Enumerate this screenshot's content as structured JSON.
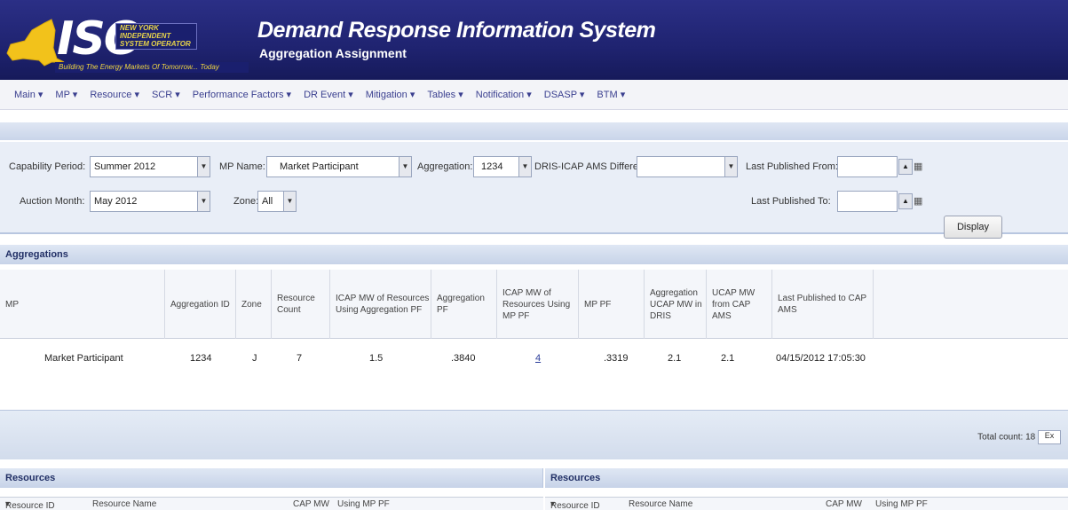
{
  "header": {
    "logo_iso": "ISO",
    "logo_org_lines": [
      "NEW YORK",
      "INDEPENDENT",
      "SYSTEM OPERATOR"
    ],
    "logo_tagline": "Building The Energy Markets Of Tomorrow... Today",
    "title": "Demand Response Information System",
    "subtitle": "Aggregation Assignment"
  },
  "menu": [
    "Main",
    "MP",
    "Resource",
    "SCR",
    "Performance Factors",
    "DR Event",
    "Mitigation",
    "Tables",
    "Notification",
    "DSASP",
    "BTM"
  ],
  "filters": {
    "capability_period_label": "Capability Period:",
    "capability_period_value": "Summer 2012",
    "auction_month_label": "Auction Month:",
    "auction_month_value": "May 2012",
    "mp_name_label": "MP Name:",
    "mp_name_value": "Market Participant",
    "zone_label": "Zone:",
    "zone_value": "All",
    "aggregation_label": "Aggregation:",
    "aggregation_value": "1234",
    "difference_label": "DRIS-ICAP AMS Difference:",
    "difference_value": "",
    "published_from_label": "Last Published From:",
    "published_to_label": "Last Published To:",
    "display_button": "Display"
  },
  "aggregations": {
    "title": "Aggregations",
    "columns": [
      "MP",
      "Aggregation ID",
      "Zone",
      "Resource Count",
      "ICAP MW of Resources Using Aggregation PF",
      "Aggregation PF",
      "ICAP MW of Resources Using MP PF",
      "MP PF",
      "Aggregation UCAP MW in DRIS",
      "UCAP MW from CAP AMS",
      "Last Published to CAP AMS"
    ],
    "rows": [
      [
        "Market Participant",
        "1234",
        "J",
        "7",
        "1.5",
        ".3840",
        "4",
        ".3319",
        "2.1",
        "2.1",
        "04/15/2012 17:05:30"
      ]
    ],
    "total_count": "Total count: 18",
    "export_label": "Ex"
  },
  "resources_left": {
    "title": "Resources",
    "columns": [
      "Resource ID",
      "Resource Name",
      "CAP MW",
      "Using MP PF"
    ]
  },
  "resources_right": {
    "title": "Resources",
    "columns": [
      "Resource ID",
      "Resource Name",
      "CAP MW",
      "Using MP PF"
    ]
  },
  "colors": {
    "header_bg": "#1f2370",
    "menu_text": "#3a3f8f",
    "logo_yellow": "#f0d640"
  }
}
